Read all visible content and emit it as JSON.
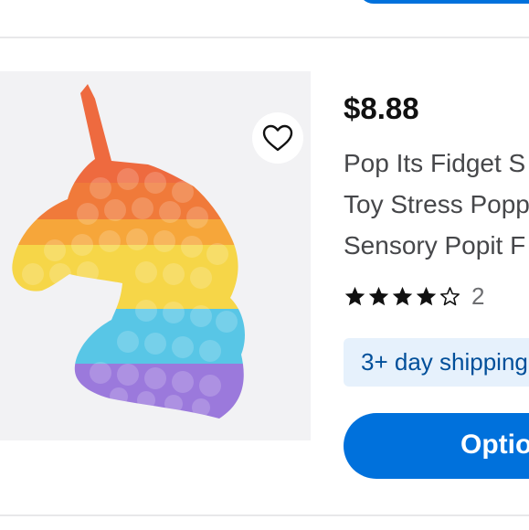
{
  "product": {
    "price": "$8.88",
    "title_lines": [
      "Pop Its Fidget S",
      "Toy Stress Popp",
      "Sensory Popit F"
    ],
    "rating": {
      "stars_filled": 4,
      "stars_total": 5,
      "review_count": "2"
    },
    "shipping": "3+ day shipping",
    "options_button": "Optio",
    "favorite_icon": "heart-outline-icon",
    "image": "rainbow-unicorn-pop-fidget-toy"
  },
  "colors": {
    "accent_blue": "#0071dc",
    "shipping_bg": "#e6f1fc",
    "shipping_text": "#004f9a",
    "price_text": "#111111",
    "title_text": "#46474a",
    "star": "#111111"
  }
}
